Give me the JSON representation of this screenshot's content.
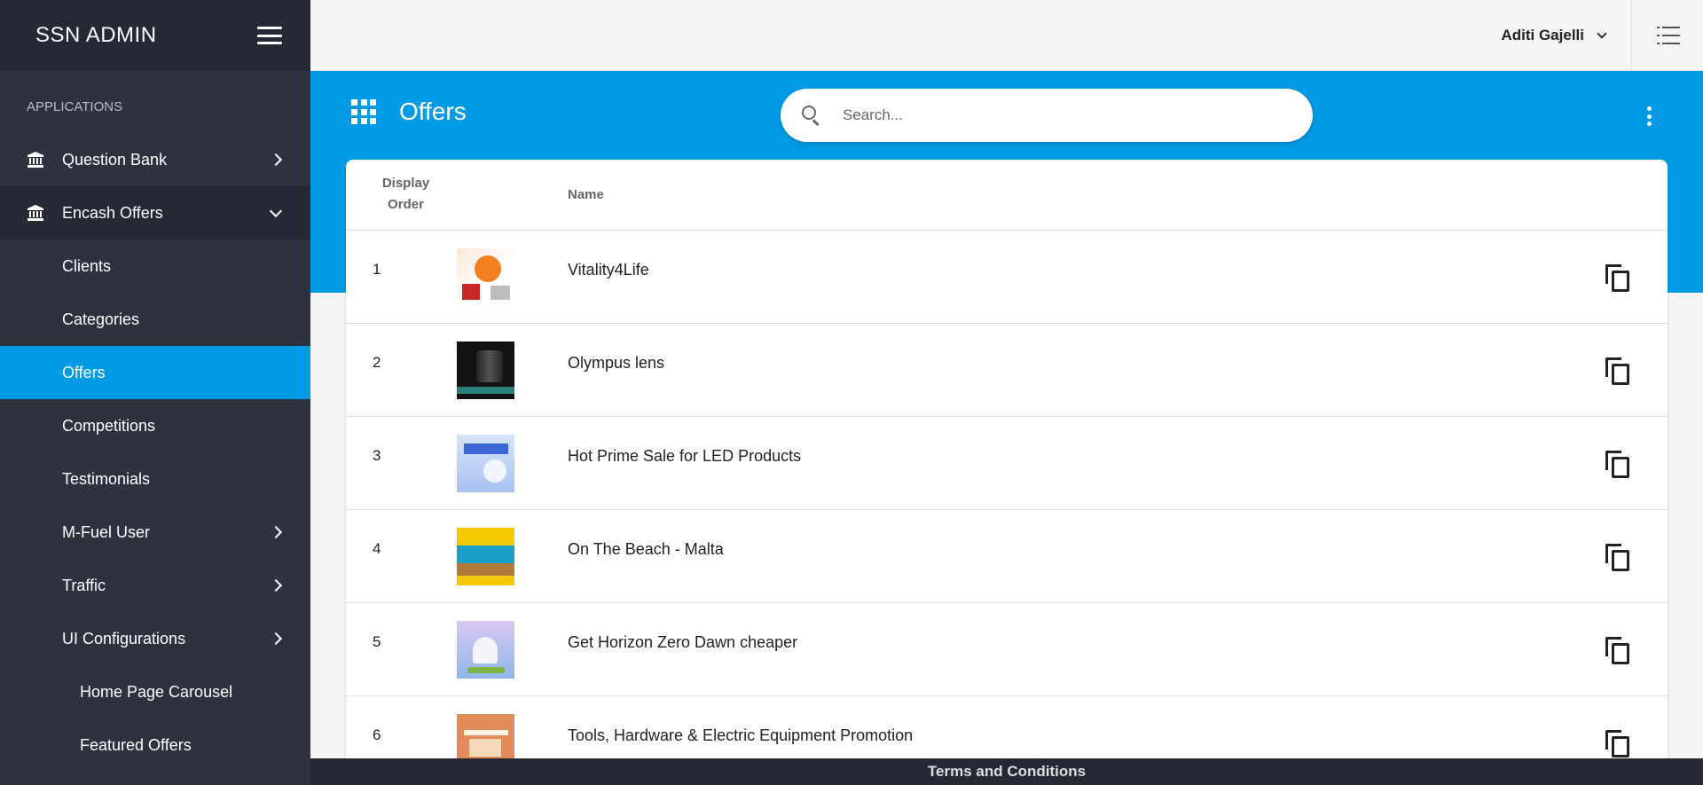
{
  "sidebar": {
    "brand": "SSN ADMIN",
    "section": "APPLICATIONS",
    "items": [
      {
        "label": "Question Bank"
      },
      {
        "label": "Encash Offers"
      },
      {
        "label": "Clients"
      },
      {
        "label": "Categories"
      },
      {
        "label": "Offers"
      },
      {
        "label": "Competitions"
      },
      {
        "label": "Testimonials"
      },
      {
        "label": "M-Fuel User"
      },
      {
        "label": "Traffic"
      },
      {
        "label": "UI Configurations"
      },
      {
        "label": "Home Page Carousel"
      },
      {
        "label": "Featured Offers"
      }
    ]
  },
  "topbar": {
    "user_name": "Aditi Gajelli"
  },
  "header": {
    "title": "Offers",
    "search_placeholder": "Search..."
  },
  "table": {
    "col_order": "Display\nOrder",
    "col_order_line1": "Display",
    "col_order_line2": "Order",
    "col_name": "Name",
    "rows": [
      {
        "order": "1",
        "name": "Vitality4Life"
      },
      {
        "order": "2",
        "name": "Olympus lens"
      },
      {
        "order": "3",
        "name": "Hot Prime Sale for LED Products"
      },
      {
        "order": "4",
        "name": "On The Beach - Malta"
      },
      {
        "order": "5",
        "name": "Get Horizon Zero Dawn cheaper"
      },
      {
        "order": "6",
        "name": "Tools, Hardware & Electric Equipment Promotion"
      }
    ]
  },
  "footer": {
    "link": "Terms and Conditions"
  },
  "colors": {
    "accent": "#039be5",
    "sidebar_bg": "#2d323e",
    "sidebar_dark": "#262933"
  }
}
